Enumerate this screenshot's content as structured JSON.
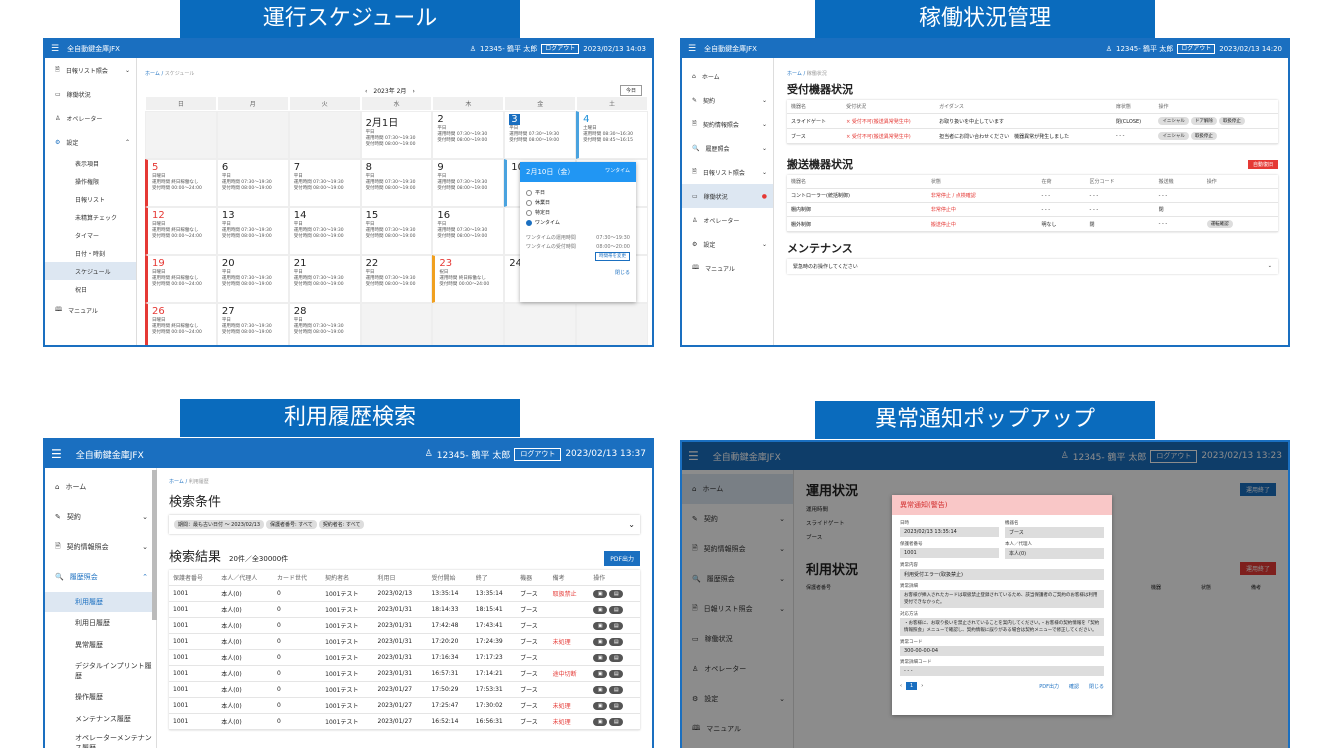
{
  "titles": {
    "t1": "運行スケジュール",
    "t2": "稼働状況管理",
    "t3": "利用履歴検索",
    "t4": "異常通知ポップアップ"
  },
  "app": {
    "name": "全自動鍵金庫JFX",
    "user": "12345- 鶴平 太郎",
    "logout": "ログアウト",
    "time1": "2023/02/13 14:03",
    "time2": "2023/02/13 14:20",
    "time3": "2023/02/13 13:37",
    "time4": "2023/02/13 13:23"
  },
  "s1": {
    "side": {
      "a": "日報リスト照会",
      "b": "稼働状況",
      "c": "オペレーター",
      "d": "設定",
      "e": "表示項目",
      "f": "操作権限",
      "g": "日報リスト",
      "h": "未精算チェック",
      "i": "タイマー",
      "j": "日付・時刻",
      "k": "スケジュール",
      "l": "祝日",
      "m": "マニュアル"
    },
    "crumb_home": "ホーム",
    "crumb_cur": "スケジュール",
    "month": "2023年 2月",
    "today": "今日",
    "wd": [
      "日",
      "月",
      "火",
      "水",
      "木",
      "金",
      "土"
    ],
    "wd_text": "平日",
    "sat_text": "土曜日",
    "sun_text": "日曜日",
    "hol_text": "祝日",
    "op1": "運用時間 07:30〜19:30",
    "op2": "受付時間 08:00〜19:00",
    "sop1": "運用時間 08:30〜16:30",
    "sop2": "受付時間 08:45〜16:15",
    "hop1": "運用時間 終日稼働なし",
    "hop2": "受付時間 00:00〜24:00",
    "feb1": "2月1日",
    "d2": "2",
    "d3": "3",
    "d4": "4",
    "d5": "5",
    "d6": "6",
    "d7": "7",
    "d8": "8",
    "d9": "9",
    "d10": "10",
    "d12": "12",
    "d13": "13",
    "d14": "14",
    "d15": "15",
    "d16": "16",
    "d19": "19",
    "d20": "20",
    "d21": "21",
    "d22": "22",
    "d23": "23",
    "d24": "24",
    "d26": "26",
    "d27": "27",
    "d28": "28",
    "pop": {
      "date": "2月10日（金）",
      "mode": "ワンタイム",
      "r1": "平日",
      "r2": "休業日",
      "r3": "特定日",
      "r4": "ワンタイム",
      "l1": "ワンタイムの運用時間",
      "v1": "07:30〜19:30",
      "l2": "ワンタイムの受付時間",
      "v2": "08:00〜20:00",
      "change": "時間帯を変更",
      "close": "閉じる"
    }
  },
  "s2": {
    "side": [
      "ホーム",
      "契約",
      "契約情報照会",
      "履歴照会",
      "日報リスト照会",
      "稼働状況",
      "オペレーター",
      "設定",
      "マニュアル"
    ],
    "crumb_home": "ホーム",
    "crumb_cur": "稼働状況",
    "h1": "受付機器状況",
    "h2": "搬送機器状況",
    "h3": "メンテナンス",
    "auto": "自動復旧",
    "t1h": [
      "機器名",
      "受付状況",
      "ガイダンス",
      "扉状態",
      "操作"
    ],
    "t1r": [
      [
        "スライドゲート",
        "× 受付不可(搬送異常発生中)",
        "お取り扱いを中止しています",
        "閉(CLOSE)"
      ],
      [
        "ブース",
        "× 受付不可(搬送異常発生中)",
        "担当者にお問い合わせください　機器異常が発生しました",
        "- - -"
      ]
    ],
    "t1b": [
      "イニシャル",
      "ドア解除",
      "取扱停止"
    ],
    "t2h": [
      "機器名",
      "状態",
      "在荷",
      "区分コード",
      "搬送機",
      "操作"
    ],
    "t2r": [
      [
        "コントローラー(統括制御)",
        "非常停止 / 点検確認",
        "- - -",
        "- - -",
        "- - -"
      ],
      [
        "棚内制御",
        "非常停止中",
        "- - -",
        "- - -",
        "閉"
      ],
      [
        "棚外制御",
        "搬送停止中",
        "明なし",
        "閉",
        "- - -"
      ]
    ],
    "t2b": "運転確認",
    "maint": "緊急時のお操作してください"
  },
  "s3": {
    "side": [
      "ホーム",
      "契約",
      "契約情報照会",
      "履歴照会",
      "利用履歴",
      "利用日履歴",
      "異常履歴",
      "デジタルインプリント履歴",
      "操作履歴",
      "メンテナンス履歴",
      "オペレーターメンテナンス履歴"
    ],
    "crumb_home": "ホーム",
    "crumb_cur": "利用履歴",
    "h1": "検索条件",
    "c1": "期間：最も古い日付 〜 2023/02/13",
    "c2": "保護者番号: すべて",
    "c3": "契約者名: すべて",
    "h2": "検索結果",
    "count": "20件／全30000件",
    "pdf": "PDF出力",
    "cols": [
      "保護者番号",
      "本人／代理人",
      "カード世代",
      "契約者名",
      "利用日",
      "受付開始",
      "終了",
      "機器",
      "備考",
      "操作"
    ],
    "rows": [
      [
        "1001",
        "本人(0)",
        "0",
        "1001テスト",
        "2023/02/13",
        "13:35:14",
        "13:35:14",
        "ブース",
        "取扱禁止"
      ],
      [
        "1001",
        "本人(0)",
        "0",
        "1001テスト",
        "2023/01/31",
        "18:14:33",
        "18:15:41",
        "ブース",
        ""
      ],
      [
        "1001",
        "本人(0)",
        "0",
        "1001テスト",
        "2023/01/31",
        "17:42:48",
        "17:43:41",
        "ブース",
        ""
      ],
      [
        "1001",
        "本人(0)",
        "0",
        "1001テスト",
        "2023/01/31",
        "17:20:20",
        "17:24:39",
        "ブース",
        "未処理"
      ],
      [
        "1001",
        "本人(0)",
        "0",
        "1001テスト",
        "2023/01/31",
        "17:16:34",
        "17:17:23",
        "ブース",
        ""
      ],
      [
        "1001",
        "本人(0)",
        "0",
        "1001テスト",
        "2023/01/31",
        "16:57:31",
        "17:14:21",
        "ブース",
        "途中切断"
      ],
      [
        "1001",
        "本人(0)",
        "0",
        "1001テスト",
        "2023/01/27",
        "17:50:29",
        "17:53:31",
        "ブース",
        ""
      ],
      [
        "1001",
        "本人(0)",
        "0",
        "1001テスト",
        "2023/01/27",
        "17:25:47",
        "17:30:02",
        "ブース",
        "未処理"
      ],
      [
        "1001",
        "本人(0)",
        "0",
        "1001テスト",
        "2023/01/27",
        "16:52:14",
        "16:56:31",
        "ブース",
        "未処理"
      ]
    ]
  },
  "s4": {
    "side": [
      "ホーム",
      "契約",
      "契約情報照会",
      "履歴照会",
      "日報リスト照会",
      "稼働状況",
      "オペレーター",
      "設定",
      "マニュアル"
    ],
    "h1": "運用状況",
    "h2": "利用状況",
    "end": "運用終了",
    "end2": "運用終了",
    "bg1": [
      "運用時間",
      "スライドゲート",
      "ブース"
    ],
    "bg2": [
      "保護者番号",
      "機器",
      "状態",
      "備考"
    ],
    "pop": {
      "title": "異常通知(警告)",
      "l_dt": "日時",
      "v_dt": "2023/02/13 13:35:14",
      "l_dev": "機器名",
      "v_dev": "ブース",
      "l_no": "保護者番号",
      "v_no": "1001",
      "l_who": "本人／代理人",
      "v_who": "本人(0)",
      "l_cont": "異常内容",
      "v_cont": "利用受付エラー(取扱禁止)",
      "l_det": "異常詳細",
      "v_det": "お客様が挿入されたカードは取扱禁止登録されているため、該当保護者のご契約のお客様は利用受付できなかった。",
      "l_fix": "対応方法",
      "v_fix": "・お客様に、お取り扱いを禁止されていることを案内してください。・お客様の契約情報を「契約情報照会」メニューで確認し、契約情報に誤りがある場合は契約メニューで修正してください。",
      "l_code": "異常コード",
      "v_code": "300-00-00-04",
      "l_dcode": "異常詳細コード",
      "v_dcode": "- - -",
      "page": "1",
      "pdf": "PDF出力",
      "ok": "確認",
      "close": "閉じる"
    }
  }
}
